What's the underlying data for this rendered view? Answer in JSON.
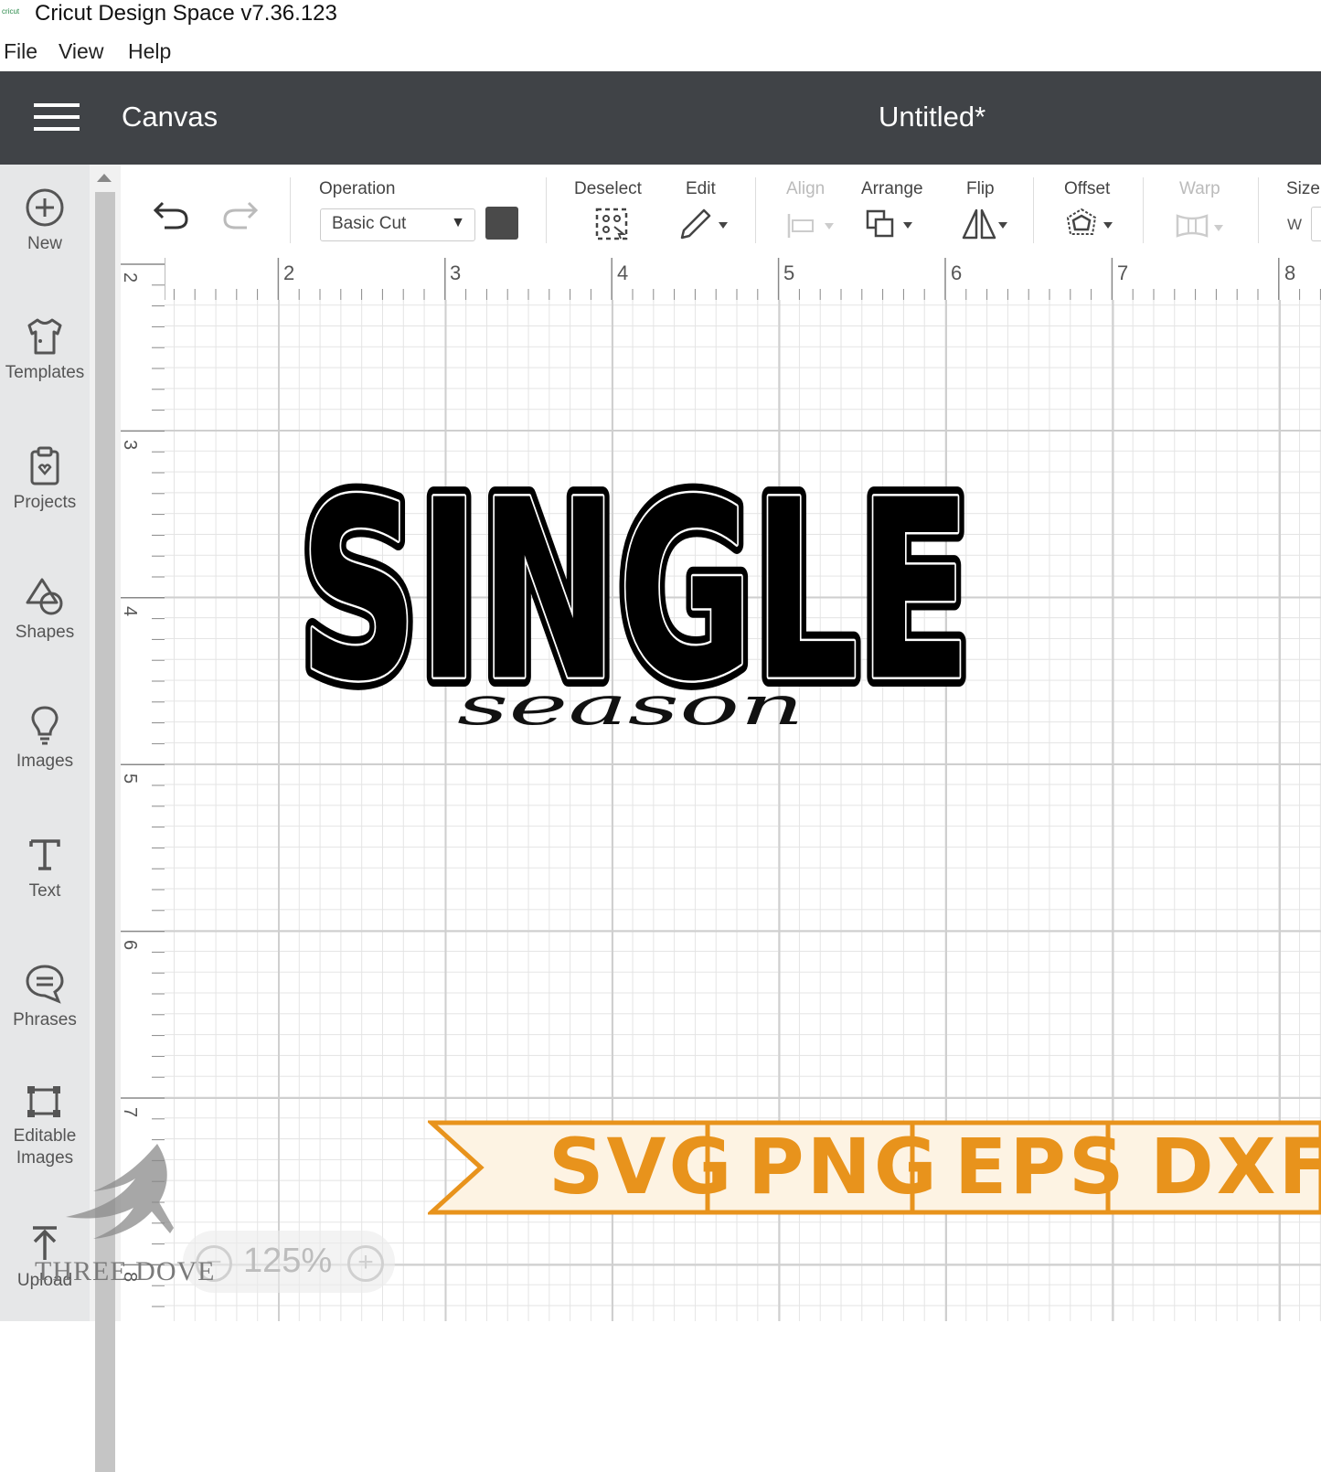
{
  "window": {
    "logo_text": "cricut",
    "title": "Cricut Design Space  v7.36.123"
  },
  "menu": [
    "File",
    "View",
    "Help"
  ],
  "header": {
    "section": "Canvas",
    "document_title": "Untitled*"
  },
  "sidebar": [
    {
      "label": "New",
      "icon": "plus-circle-icon"
    },
    {
      "label": "Templates",
      "icon": "tshirt-icon"
    },
    {
      "label": "Projects",
      "icon": "clipboard-icon"
    },
    {
      "label": "Shapes",
      "icon": "shapes-icon"
    },
    {
      "label": "Images",
      "icon": "lightbulb-icon"
    },
    {
      "label": "Text",
      "icon": "text-icon"
    },
    {
      "label": "Phrases",
      "icon": "speech-bubble-icon"
    },
    {
      "label": "Editable",
      "label2": "Images",
      "icon": "editable-image-icon"
    },
    {
      "label": "Upload",
      "icon": "upload-icon"
    }
  ],
  "toolbar": {
    "operation_label": "Operation",
    "operation_value": "Basic Cut",
    "operation_color": "#4a4a4a",
    "deselect_label": "Deselect",
    "edit_label": "Edit",
    "align_label": "Align",
    "arrange_label": "Arrange",
    "flip_label": "Flip",
    "offset_label": "Offset",
    "warp_label": "Warp",
    "size_label": "Size",
    "size_w_label": "W"
  },
  "ruler": {
    "horizontal": [
      "2",
      "3",
      "4",
      "5",
      "6",
      "7",
      "8"
    ],
    "vertical": [
      "2",
      "3",
      "4",
      "5",
      "6",
      "7",
      "8"
    ]
  },
  "design": {
    "main_text": "SINGLE",
    "script_text": "season"
  },
  "banner": {
    "formats": [
      "SVG",
      "PNG",
      "EPS",
      "DXF"
    ],
    "color": "#e8931c",
    "background": "#fdf3e3"
  },
  "zoom": {
    "level": "125%"
  },
  "watermark": {
    "text": "THREE DOVE"
  }
}
